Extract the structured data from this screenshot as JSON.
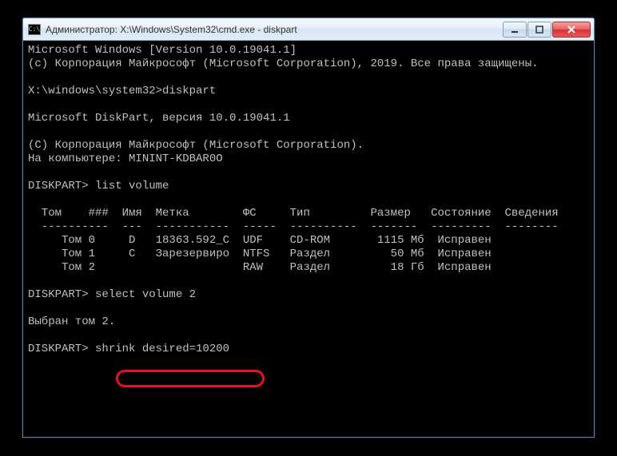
{
  "titlebar": {
    "title": "Администратор: X:\\Windows\\System32\\cmd.exe - diskpart"
  },
  "terminal": {
    "lines": [
      "Microsoft Windows [Version 10.0.19041.1]",
      "(c) Корпорация Майкрософт (Microsoft Corporation), 2019. Все права защищены.",
      "",
      "X:\\windows\\system32>diskpart",
      "",
      "Microsoft DiskPart, версия 10.0.19041.1",
      "",
      "(C) Корпорация Майкрософт (Microsoft Corporation).",
      "На компьютере: MININT-KDBAR0O",
      "",
      "DISKPART> list volume",
      "",
      "  Том    ###  Имя  Метка        ФС     Тип         Размер   Состояние  Сведения",
      "  ----------  ---  -----------  -----  ----------  -------  ---------  --------",
      "     Том 0     D   18363.592_C  UDF    CD-ROM       1115 Мб  Исправен",
      "     Том 1     C   Зарезервиро  NTFS   Раздел         50 Мб  Исправен",
      "     Том 2                      RAW    Раздел         18 Гб  Исправен",
      "",
      "DISKPART> select volume 2",
      "",
      "Выбран том 2.",
      "",
      "DISKPART> shrink desired=10200"
    ]
  },
  "highlighted_command": "shrink desired=10200"
}
